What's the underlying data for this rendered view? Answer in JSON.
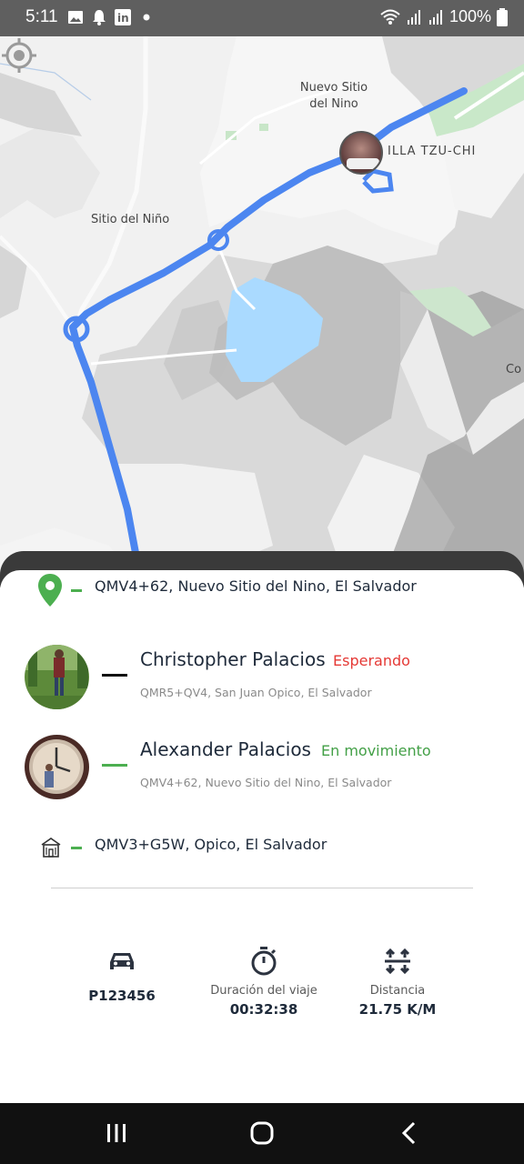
{
  "status_bar": {
    "time": "5:11",
    "battery": "100%",
    "left_icons": [
      "image-icon",
      "bell-icon",
      "linkedin-icon",
      "dot-icon"
    ],
    "right_icons": [
      "wifi-icon",
      "signal-icon",
      "signal-icon",
      "battery-icon"
    ]
  },
  "map": {
    "labels": {
      "nuevo_sitio": "Nuevo Sitio\ndel Nino",
      "sitio_del_nino": "Sitio del Niño",
      "villa": "ILLA TZU-CHI",
      "edge": "Co"
    },
    "route_color": "#4c86f0"
  },
  "trip": {
    "origin": {
      "address": "QMV4+62, Nuevo Sitio del Nino, El Salvador",
      "icon": "location-pin-icon",
      "color": "#4caf50"
    },
    "passengers": [
      {
        "name": "Christopher Palacios",
        "status": "Esperando",
        "status_color": "#e53935",
        "address": "QMR5+QV4, San Juan Opico, El Salvador",
        "dash_color": "#111111"
      },
      {
        "name": "Alexander Palacios",
        "status": "En movimiento",
        "status_color": "#43a047",
        "address": "QMV4+62, Nuevo Sitio del Nino, El Salvador",
        "dash_color": "#4caf50"
      }
    ],
    "destination": {
      "address": "QMV3+G5W, Opico, El Salvador",
      "icon": "school-building-icon"
    }
  },
  "stats": {
    "vehicle": {
      "icon": "car-icon",
      "label": "",
      "value": "P123456"
    },
    "duration": {
      "icon": "stopwatch-icon",
      "label": "Duración del viaje",
      "value": "00:32:38"
    },
    "distance": {
      "icon": "distance-icon",
      "label": "Distancia",
      "value": "21.75 K/M"
    }
  },
  "nav_bar": {
    "buttons": [
      "recent-apps-icon",
      "home-icon",
      "back-icon"
    ]
  }
}
